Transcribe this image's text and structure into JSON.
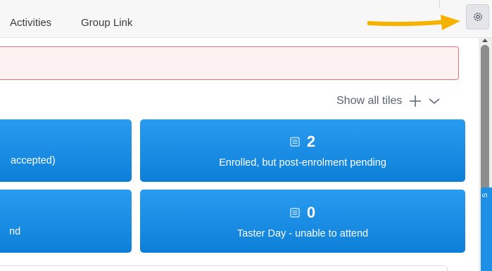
{
  "tabs": [
    {
      "label": "Activities"
    },
    {
      "label": "Group Link"
    }
  ],
  "toolbar": {
    "show_all_label": "Show all tiles"
  },
  "tiles": [
    {
      "count": "",
      "label": "accepted)"
    },
    {
      "count": "2",
      "label": "Enrolled, but post-enrolment pending"
    },
    {
      "count": "",
      "label": "nd"
    },
    {
      "count": "0",
      "label": "Taster Day - unable to attend"
    }
  ],
  "side_tab": {
    "label": "S"
  },
  "colors": {
    "tile_blue": "#1e8fe6",
    "alert_border": "#e57373",
    "alert_bg": "#fdf1f1",
    "arrow_yellow": "#f5b300"
  }
}
